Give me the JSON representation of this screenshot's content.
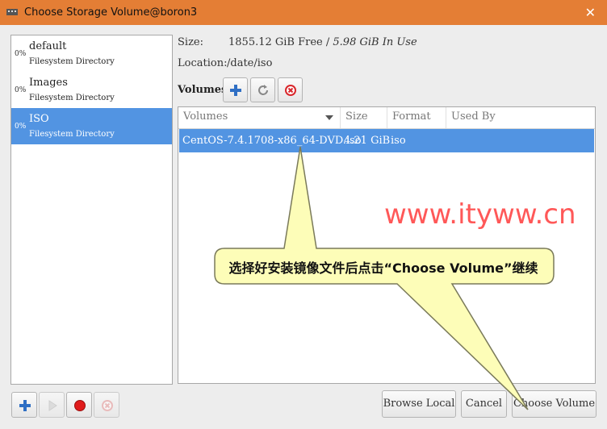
{
  "window": {
    "title": "Choose Storage Volume@boron3",
    "close_glyph": "✕"
  },
  "pools": [
    {
      "percent": "0%",
      "name": "default",
      "type": "Filesystem Directory"
    },
    {
      "percent": "0%",
      "name": "Images",
      "type": "Filesystem Directory"
    },
    {
      "percent": "0%",
      "name": "ISO",
      "type": "Filesystem Directory"
    }
  ],
  "info": {
    "size_label": "Size:",
    "size_free": "1855.12 GiB Free / ",
    "size_inuse": "5.98 GiB In Use",
    "location_label": "Location:",
    "location_value": "/date/iso"
  },
  "volumes": {
    "label": "Volumes",
    "toolbar_icons": [
      "add-icon",
      "refresh-icon",
      "delete-icon"
    ],
    "columns": [
      "Volumes",
      "Size",
      "Format",
      "Used By"
    ],
    "rows": [
      {
        "name": "CentOS-7.4.1708-x86_64-DVD.iso",
        "size": "4.21 GiB",
        "format": "iso",
        "used_by": ""
      }
    ]
  },
  "pool_toolbar_icons": [
    "add-icon",
    "play-icon",
    "stop-icon",
    "delete-icon"
  ],
  "dialog_buttons": {
    "browse_local": "Browse Local",
    "cancel": "Cancel",
    "choose_volume": "Choose Volume"
  },
  "annotation": {
    "callout_text": "选择好安装镜像文件后点击“Choose Volume”继续",
    "watermark": "www.ityww.cn"
  },
  "colors": {
    "titlebar": "#e47e35",
    "selection": "#5294e2",
    "callout_fill": "#fdfdb8",
    "watermark": "#ff3b3b"
  }
}
